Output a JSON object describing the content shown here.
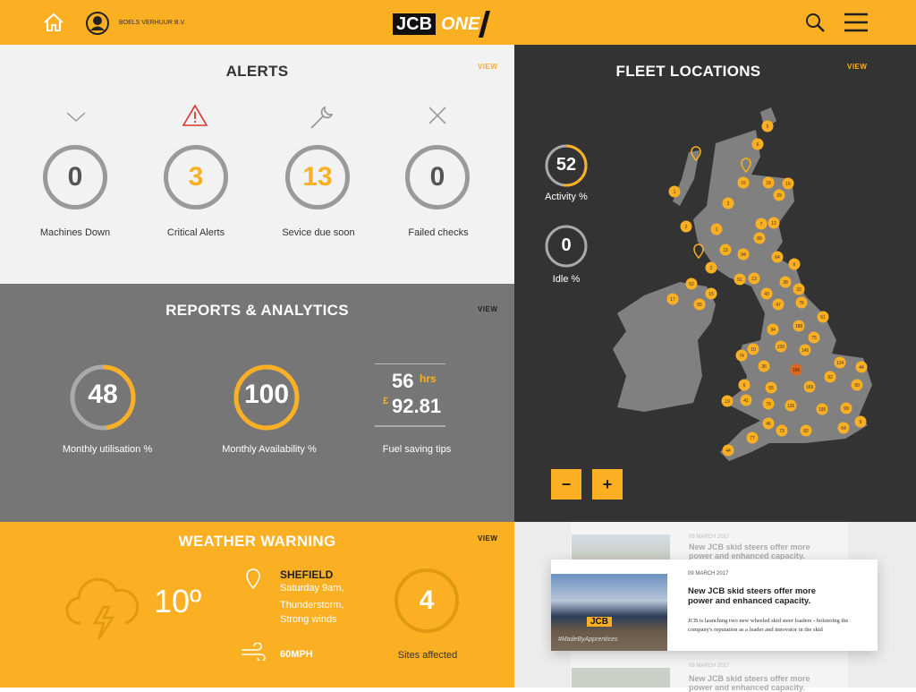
{
  "header": {
    "company": "BOELS VERHUUR B.V.",
    "logo_text": "JCB",
    "logo_suffix": "ONE",
    "icons": [
      "home-icon",
      "user-avatar-icon",
      "search-icon",
      "menu-icon"
    ]
  },
  "colors": {
    "accent": "#FBAF22",
    "dark": "#333333",
    "gray": "#767676",
    "light": "#F2F2F2",
    "critical": "#D9342B"
  },
  "alerts": {
    "title": "ALERTS",
    "view": "VIEW",
    "items": [
      {
        "icon": "chevron-down-icon",
        "value": "0",
        "label": "Machines Down"
      },
      {
        "icon": "warning-icon",
        "value": "3",
        "label": "Critical Alerts"
      },
      {
        "icon": "wrench-icon",
        "value": "13",
        "label": "Sevice due soon"
      },
      {
        "icon": "close-icon",
        "value": "0",
        "label": "Failed checks"
      }
    ]
  },
  "reports": {
    "title": "REPORTS & ANALYTICS",
    "view": "VIEW",
    "utilisation": {
      "value": "48",
      "percent": 48,
      "label": "Monthly utilisation %"
    },
    "availability": {
      "value": "100",
      "percent": 100,
      "label": "Monthly Availability %"
    },
    "fuel": {
      "hours": "56",
      "hours_unit": "hrs",
      "currency": "£",
      "amount": "92.81",
      "label": "Fuel saving tips"
    }
  },
  "weather": {
    "title": "WEATHER WARNING",
    "view": "VIEW",
    "temp": "10º",
    "location": "SHEFIELD",
    "when": "Saturday 9am,",
    "condition": "Thunderstorm,",
    "detail": "Strong winds",
    "wind": "60MPH",
    "sites_value": "4",
    "sites_label": "Sites affected"
  },
  "fleet": {
    "title": "FLEET LOCATIONS",
    "view": "VIEW",
    "activity": {
      "value": "52",
      "percent": 52,
      "label": "Activity %"
    },
    "idle": {
      "value": "0",
      "percent": 0,
      "label": "Idle %"
    },
    "zoom_out": "−",
    "zoom_in": "+",
    "markers": [
      "5",
      "6",
      "1",
      "16",
      "18",
      "16",
      "29",
      "2",
      "7",
      "12",
      "2",
      "1",
      "89",
      "15",
      "94",
      "64",
      "6",
      "2",
      "51",
      "13",
      "38",
      "33",
      "52",
      "15",
      "17",
      "55",
      "43",
      "47",
      "76",
      "51",
      "34",
      "188",
      "75",
      "10",
      "220",
      "145",
      "74",
      "36",
      "186",
      "124",
      "44",
      "92",
      "6",
      "55",
      "169",
      "90",
      "19",
      "41",
      "79",
      "126",
      "195",
      "99",
      "9",
      "46",
      "73",
      "82",
      "64",
      "77",
      "44"
    ],
    "highlight_marker": "186"
  },
  "news": {
    "items": [
      {
        "date": "09 MARCH 2017",
        "title": "New JCB skid steers offer more power and enhanced capacity."
      },
      {
        "date": "09 MARCH 2017",
        "title": "New JCB skid steers offer more power and enhanced capacity.",
        "body": "JCB is launching two new wheeled skid steer loaders - bolstering the company's reputation as a leader and innovator in the skid",
        "image_text": "#MadeByApprentices"
      },
      {
        "date": "09 MARCH 2017",
        "title": "New JCB skid steers offer more power and enhanced capacity."
      }
    ]
  }
}
